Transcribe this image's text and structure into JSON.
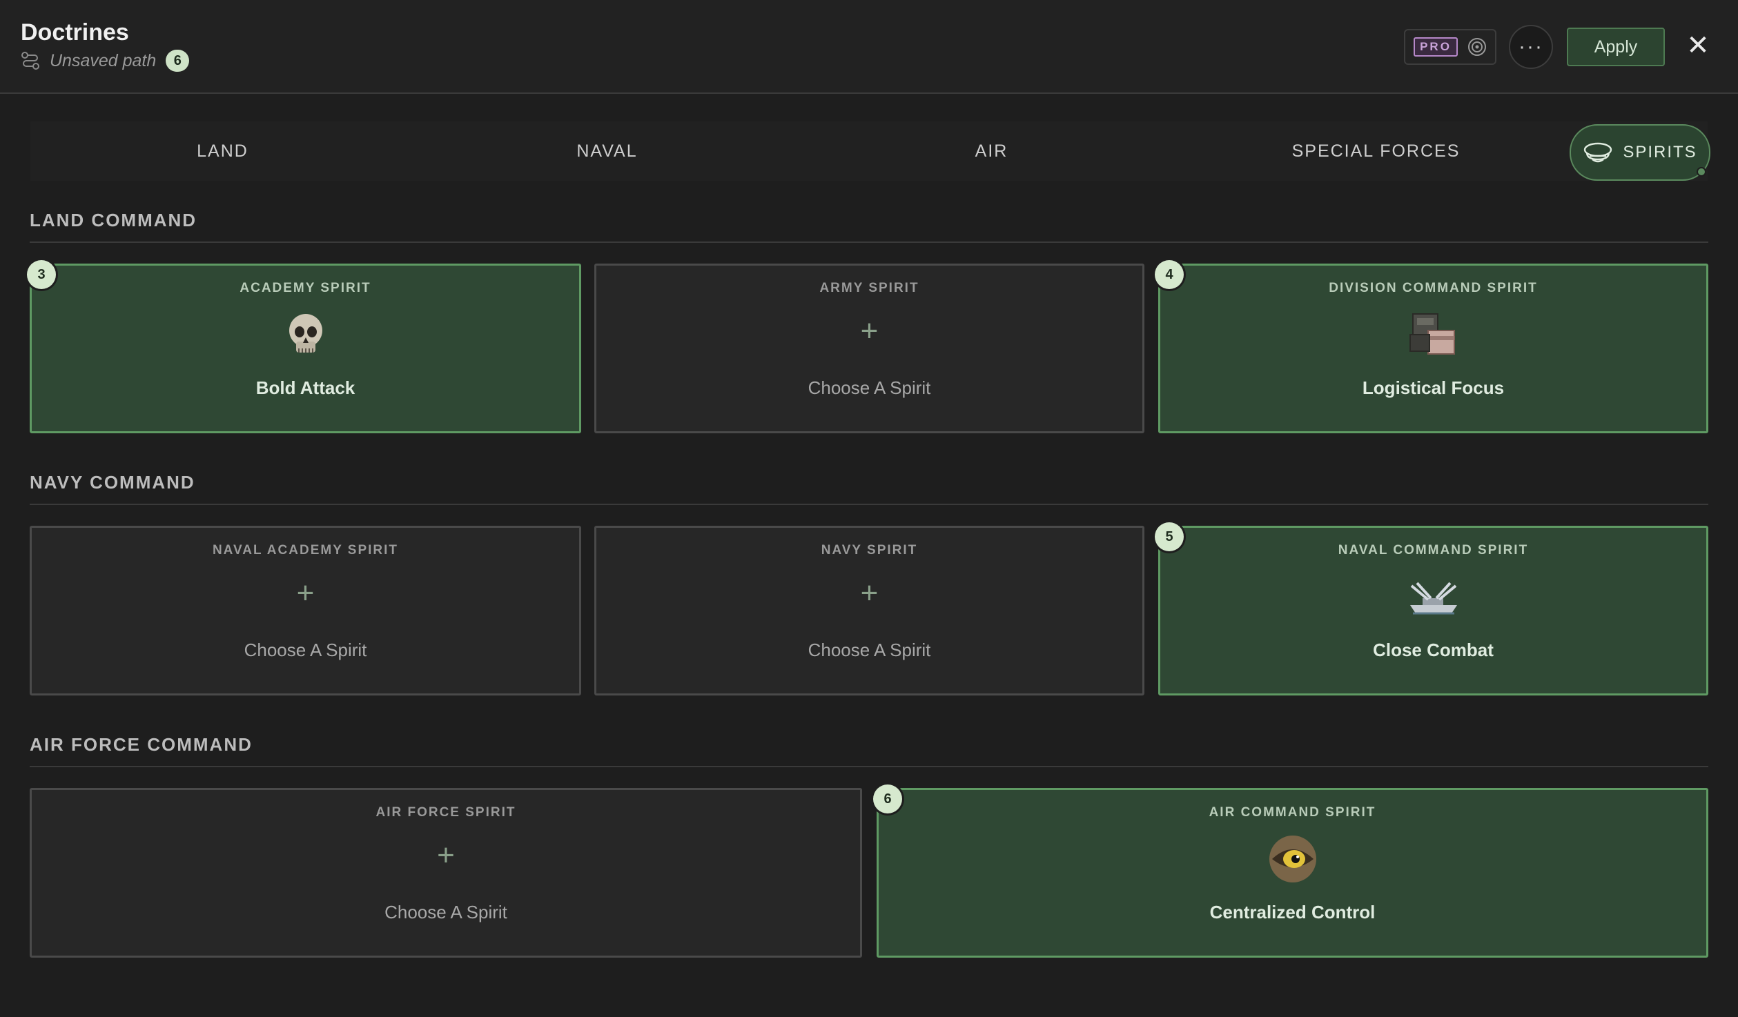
{
  "header": {
    "title": "Doctrines",
    "subtitle": "Unsaved path",
    "path_count": "6",
    "pro_label": "PRO",
    "more_label": "···",
    "apply_label": "Apply",
    "close_label": "✕"
  },
  "tabs": [
    {
      "label": "LAND"
    },
    {
      "label": "NAVAL"
    },
    {
      "label": "AIR"
    },
    {
      "label": "SPECIAL FORCES"
    },
    {
      "label": "SPIRITS",
      "active": true
    }
  ],
  "sections": [
    {
      "title": "LAND COMMAND",
      "cards": [
        {
          "label": "ACADEMY SPIRIT",
          "name": "Bold Attack",
          "filled": true,
          "order": "3",
          "icon": "skull-icon"
        },
        {
          "label": "ARMY SPIRIT",
          "name": "Choose A Spirit",
          "filled": false,
          "plus": "+"
        },
        {
          "label": "DIVISION COMMAND SPIRIT",
          "name": "Logistical Focus",
          "filled": true,
          "order": "4",
          "icon": "supply-crates-icon"
        }
      ]
    },
    {
      "title": "NAVY COMMAND",
      "cards": [
        {
          "label": "NAVAL ACADEMY SPIRIT",
          "name": "Choose A Spirit",
          "filled": false,
          "plus": "+"
        },
        {
          "label": "NAVY SPIRIT",
          "name": "Choose A Spirit",
          "filled": false,
          "plus": "+"
        },
        {
          "label": "NAVAL COMMAND SPIRIT",
          "name": "Close Combat",
          "filled": true,
          "order": "5",
          "icon": "warship-icon"
        }
      ]
    },
    {
      "title": "AIR FORCE COMMAND",
      "cards": [
        {
          "label": "AIR FORCE SPIRIT",
          "name": "Choose A Spirit",
          "filled": false,
          "plus": "+"
        },
        {
          "label": "AIR COMMAND SPIRIT",
          "name": "Centralized Control",
          "filled": true,
          "order": "6",
          "icon": "eagle-eye-icon"
        }
      ]
    }
  ],
  "colors": {
    "background": "#1e1e1e",
    "filled_card": "#2f4834",
    "filled_border": "#5f9a63",
    "badge": "#d6e9ce",
    "pro": "#c9a3d9"
  }
}
